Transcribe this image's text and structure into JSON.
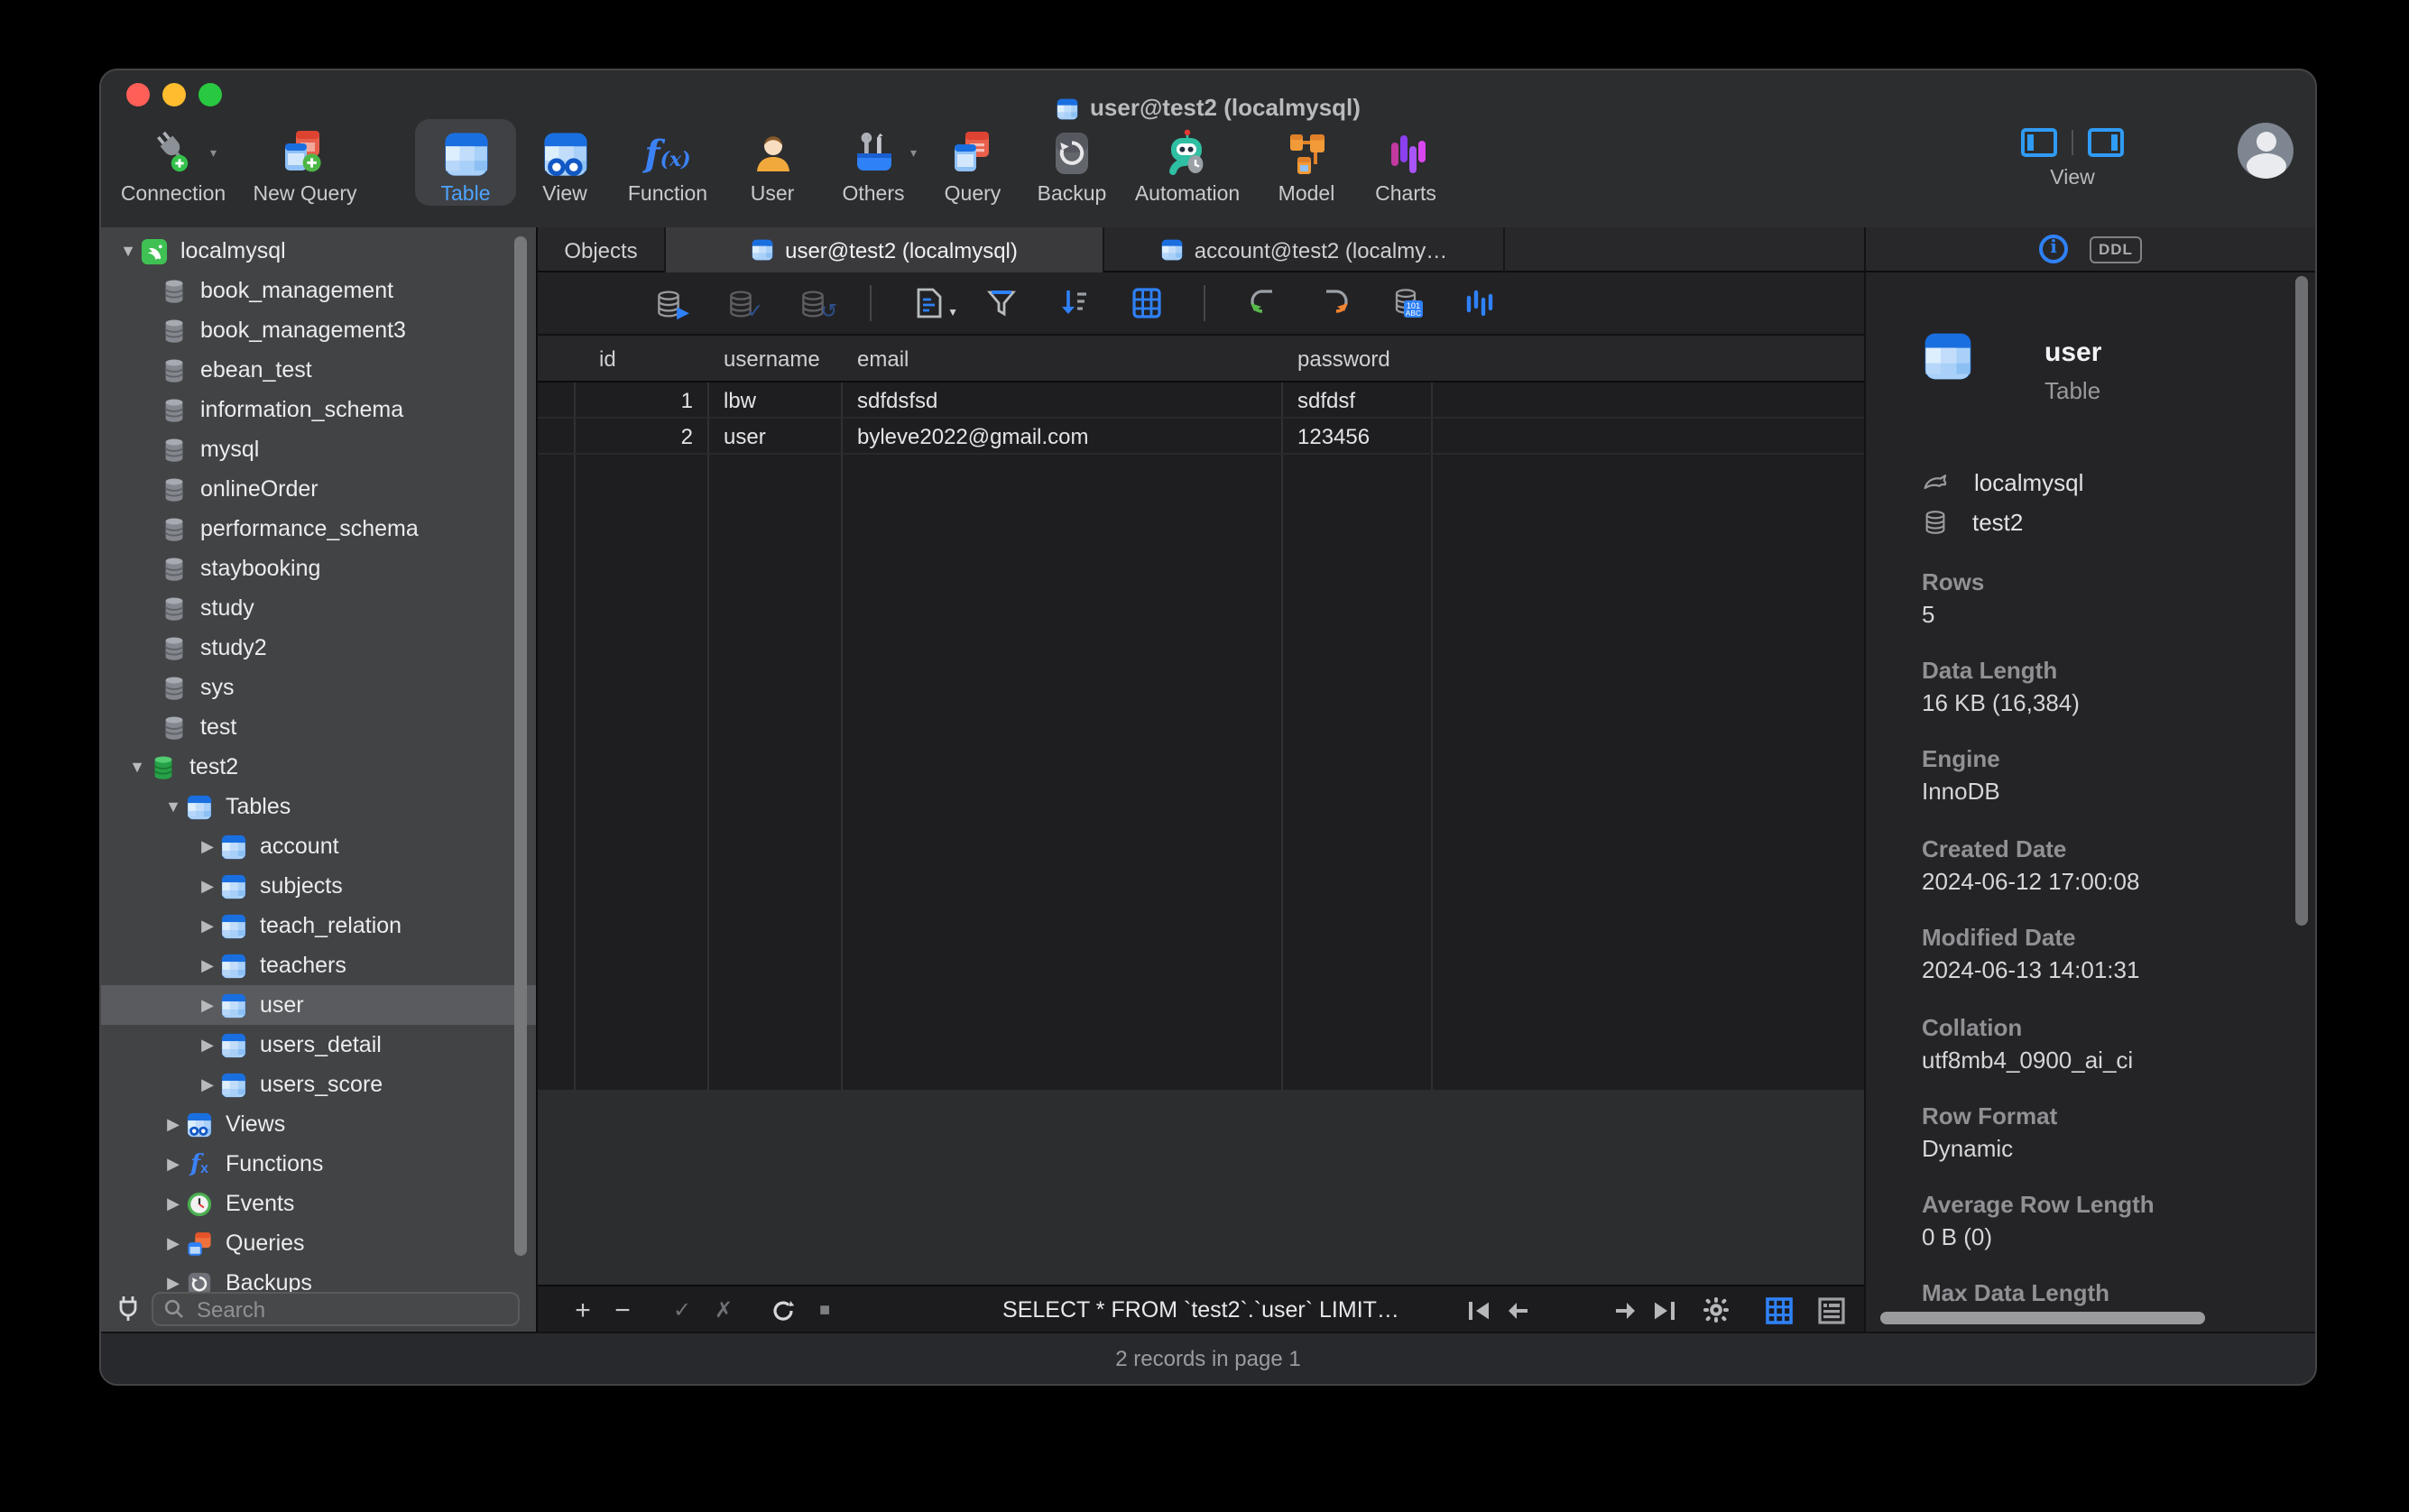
{
  "window_title": {
    "text": "user@test2 (localmysql)"
  },
  "toolbar": {
    "items": [
      {
        "label": "Connection",
        "icon": "connection-plug-icon"
      },
      {
        "label": "New Query",
        "icon": "new-query-icon"
      },
      {
        "label": "Table",
        "icon": "table-icon",
        "active": true
      },
      {
        "label": "View",
        "icon": "view-icon"
      },
      {
        "label": "Function",
        "icon": "function-icon"
      },
      {
        "label": "User",
        "icon": "user-icon"
      },
      {
        "label": "Others",
        "icon": "others-tools-icon"
      },
      {
        "label": "Query",
        "icon": "query-icon"
      },
      {
        "label": "Backup",
        "icon": "backup-icon"
      },
      {
        "label": "Automation",
        "icon": "automation-robot-icon"
      },
      {
        "label": "Model",
        "icon": "model-icon"
      },
      {
        "label": "Charts",
        "icon": "charts-icon"
      }
    ],
    "right": {
      "view_label": "View"
    }
  },
  "tabs": [
    {
      "label": "Objects",
      "active": false
    },
    {
      "label": "user@test2 (localmysql)",
      "active": true
    },
    {
      "label": "account@test2 (localmy…",
      "active": false
    }
  ],
  "sidebar": {
    "search": {
      "placeholder": "Search"
    },
    "items": [
      {
        "label": "localmysql",
        "icon": "mysql-connection-icon"
      },
      {
        "label": "book_management",
        "icon": "database-icon"
      },
      {
        "label": "book_management3",
        "icon": "database-icon"
      },
      {
        "label": "ebean_test",
        "icon": "database-icon"
      },
      {
        "label": "information_schema",
        "icon": "database-icon"
      },
      {
        "label": "mysql",
        "icon": "database-icon"
      },
      {
        "label": "onlineOrder",
        "icon": "database-icon"
      },
      {
        "label": "performance_schema",
        "icon": "database-icon"
      },
      {
        "label": "staybooking",
        "icon": "database-icon"
      },
      {
        "label": "study",
        "icon": "database-icon"
      },
      {
        "label": "study2",
        "icon": "database-icon"
      },
      {
        "label": "sys",
        "icon": "database-icon"
      },
      {
        "label": "test",
        "icon": "database-icon"
      },
      {
        "label": "test2",
        "icon": "database-open-icon"
      },
      {
        "label": "Tables",
        "icon": "table-icon"
      },
      {
        "label": "account",
        "icon": "table-icon"
      },
      {
        "label": "subjects",
        "icon": "table-icon"
      },
      {
        "label": "teach_relation",
        "icon": "table-icon"
      },
      {
        "label": "teachers",
        "icon": "table-icon"
      },
      {
        "label": "user",
        "icon": "table-icon",
        "selected": true
      },
      {
        "label": "users_detail",
        "icon": "table-icon"
      },
      {
        "label": "users_score",
        "icon": "table-icon"
      },
      {
        "label": "Views",
        "icon": "views-icon"
      },
      {
        "label": "Functions",
        "icon": "functions-icon"
      },
      {
        "label": "Events",
        "icon": "events-clock-icon"
      },
      {
        "label": "Queries",
        "icon": "queries-icon"
      },
      {
        "label": "Backups",
        "icon": "backups-icon"
      }
    ]
  },
  "grid": {
    "columns": [
      "id",
      "username",
      "email",
      "password"
    ],
    "rows": [
      {
        "id": "1",
        "username": "lbw",
        "email": "sdfdsfsd",
        "password": "sdfdsf"
      },
      {
        "id": "2",
        "username": "user",
        "email": "byleve2022@gmail.com",
        "password": "123456"
      }
    ]
  },
  "bottom_toolbar": {
    "sql_preview": "SELECT * FROM `test2`.`user` LIMIT…",
    "page_number": "1"
  },
  "status_bar": {
    "text": "2 records in page 1"
  },
  "info_panel": {
    "ddl_label": "DDL",
    "object": {
      "name": "user",
      "type": "Table"
    },
    "connection_name": "localmysql",
    "database_name": "test2",
    "fields": [
      {
        "label": "Rows",
        "value": "5"
      },
      {
        "label": "Data Length",
        "value": "16 KB (16,384)"
      },
      {
        "label": "Engine",
        "value": "InnoDB"
      },
      {
        "label": "Created Date",
        "value": "2024-06-12 17:00:08"
      },
      {
        "label": "Modified Date",
        "value": "2024-06-13 14:01:31"
      },
      {
        "label": "Collation",
        "value": "utf8mb4_0900_ai_ci"
      },
      {
        "label": "Row Format",
        "value": "Dynamic"
      },
      {
        "label": "Average Row Length",
        "value": "0 B (0)"
      },
      {
        "label": "Max Data Length",
        "value": ""
      }
    ]
  },
  "colors": {
    "accent_blue": "#2f81f7",
    "mysql_green": "#3fc153",
    "traffic_red": "#ff5f57",
    "traffic_yellow": "#febc2e",
    "traffic_green": "#28c840"
  }
}
